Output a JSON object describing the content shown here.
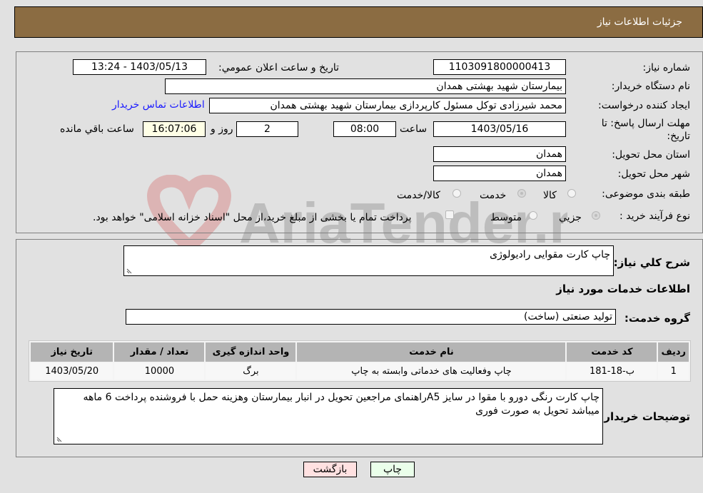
{
  "header": {
    "title": "جزئیات اطلاعات نیاز"
  },
  "form": {
    "need_number": {
      "label": "شماره نیاز:",
      "value": "1103091800000413"
    },
    "announce_datetime": {
      "label": "تاریخ و ساعت اعلان عمومي:",
      "value": "1403/05/13 - 13:24"
    },
    "buyer_org": {
      "label": "نام دستگاه خريدار:",
      "value": "بیمارستان شهید بهشتی همدان"
    },
    "requester": {
      "label": "ايجاد کننده درخواست:",
      "value": "محمد شیرزادی توکل مسئول کارپردازی بیمارستان شهید بهشتی همدان"
    },
    "buyer_contact_link": "اطلاعات تماس خريدار",
    "deadline": {
      "label_line1": "مهلت ارسال پاسخ: تا",
      "label_line2": "تاریخ:",
      "date": "1403/05/16",
      "time_label": "ساعت",
      "time": "08:00",
      "days": "2",
      "days_label": "روز و",
      "remaining": "16:07:06",
      "remaining_label": "ساعت باقي مانده"
    },
    "province": {
      "label": "استان محل تحويل:",
      "value": "همدان"
    },
    "city": {
      "label": "شهر محل تحويل:",
      "value": "همدان"
    },
    "category": {
      "label": "طبقه بندی موضوعی:",
      "options": [
        {
          "label": "کالا",
          "selected": false
        },
        {
          "label": "خدمت",
          "selected": true
        },
        {
          "label": "کالا/خدمت",
          "selected": false
        }
      ]
    },
    "purchase_process": {
      "label": "نوع فرآيند خريد :",
      "options": [
        {
          "label": "جزيي",
          "selected": true
        },
        {
          "label": "متوسط",
          "selected": false
        }
      ],
      "treasury_checkbox_label": "پرداخت تمام يا بخشی از مبلغ خريد،از محل \"اسناد خزانه اسلامی\" خواهد بود.",
      "treasury_checked": false
    }
  },
  "details": {
    "description": {
      "label": "شرح کلي نياز:",
      "value": "چاپ کارت مقوایی رادیولوژی"
    },
    "services_heading": "اطلاعات خدمات مورد نياز",
    "service_group": {
      "label": "گروه خدمت:",
      "value": "تولید صنعتی (ساخت)"
    },
    "table": {
      "headers": [
        "رديف",
        "کد خدمت",
        "نام خدمت",
        "واحد اندازه گيری",
        "تعداد / مقدار",
        "تاريخ نياز"
      ],
      "rows": [
        [
          "1",
          "ب-18-181",
          "چاپ وفعالیت های خدماتی وابسته به چاپ",
          "برگ",
          "10000",
          "1403/05/20"
        ]
      ]
    },
    "buyer_notes": {
      "label": "توضيحات خريدار:",
      "value": "چاپ کارت رنگی دورو با مقوا در سایز A5راهنمای مراجعین تحویل در انبار بیمارستان وهزینه حمل با فروشنده پرداخت 6 ماهه میباشد تحویل به صورت فوری"
    }
  },
  "buttons": {
    "print": "چاپ",
    "back": "بازگشت"
  },
  "watermark": "AriaTender.neT",
  "colors": {
    "header_bg": "#8b6c42",
    "print_bg": "#eaffea",
    "back_bg": "#ffe1e1",
    "link": "#1a1aff"
  }
}
